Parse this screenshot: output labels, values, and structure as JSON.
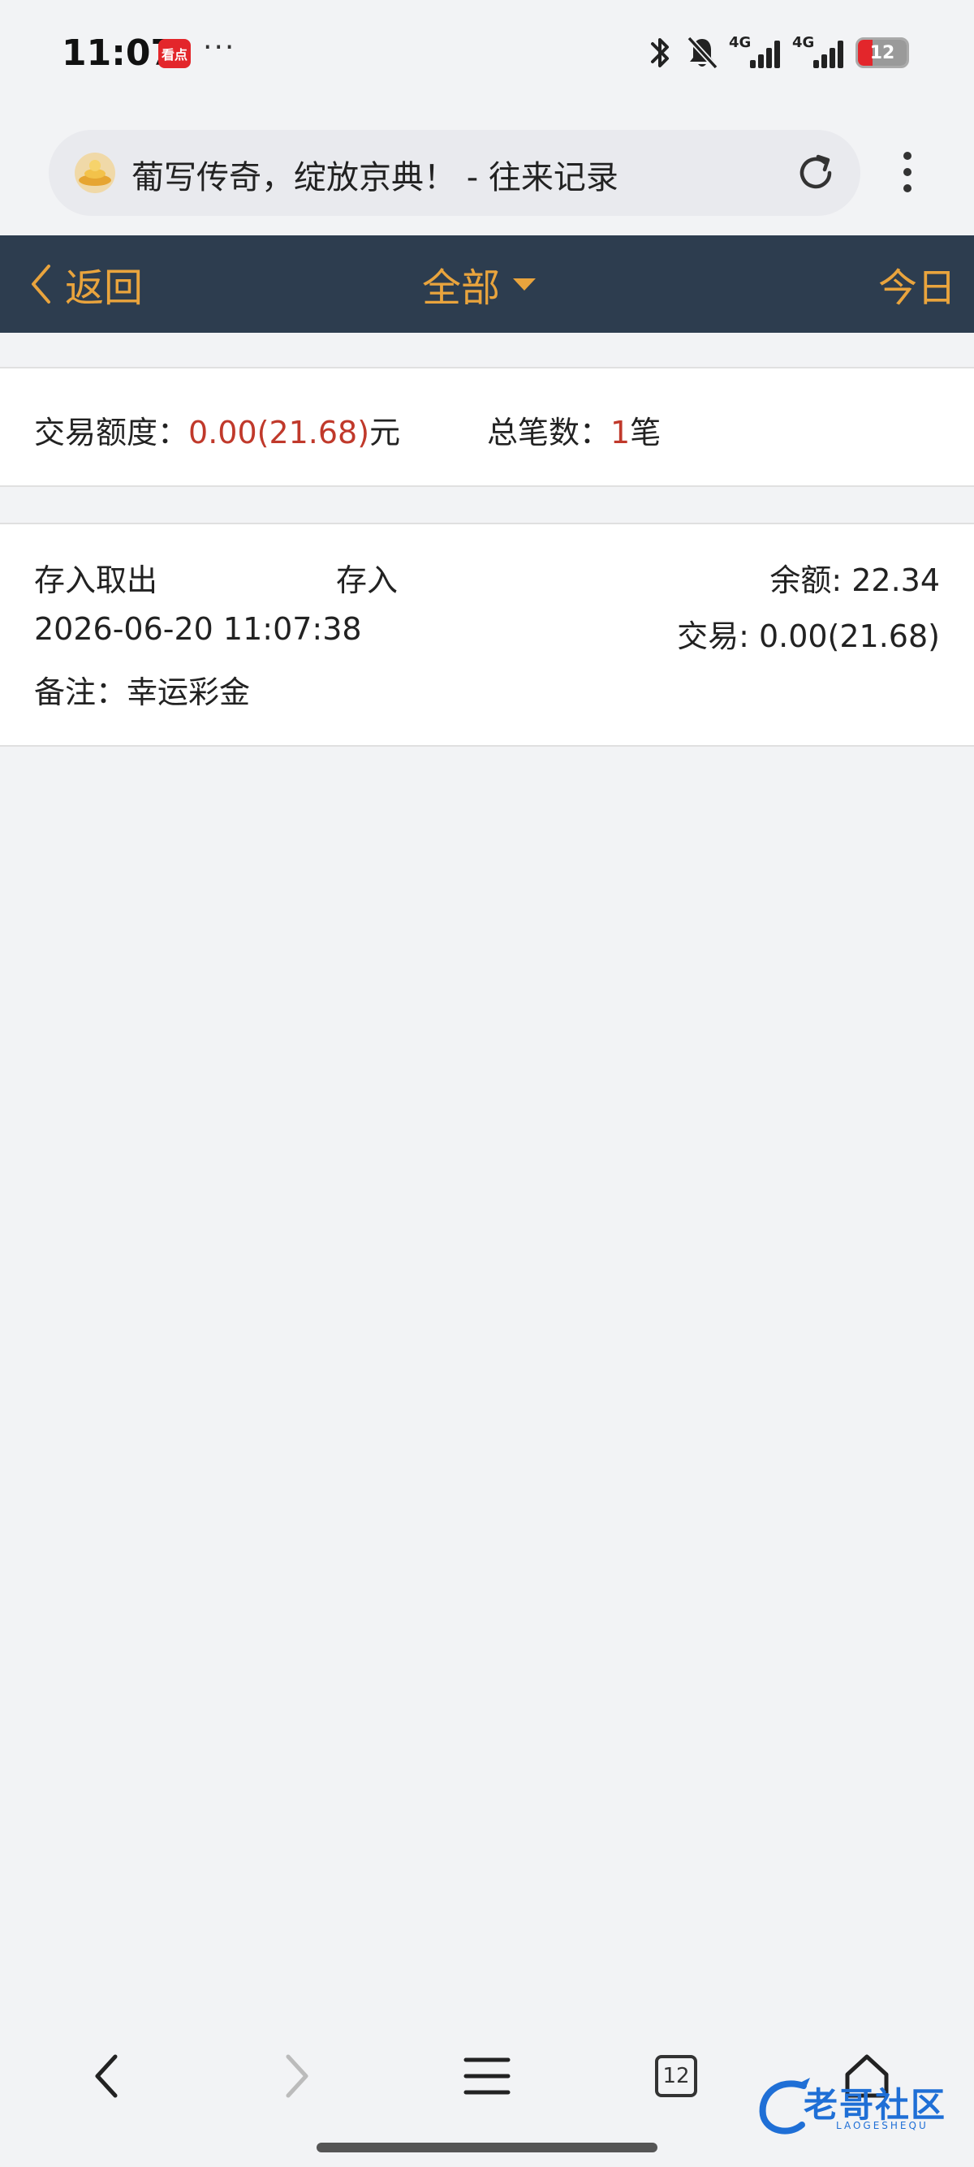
{
  "status_bar": {
    "time": "11:07",
    "app_badge": "看点",
    "more": "···",
    "network_1": "4G",
    "network_2": "4G",
    "battery": "12",
    "battery_level": 0.12
  },
  "browser": {
    "page_title": "葡写传奇，绽放京典！ - 往来记录",
    "tab_count": "12"
  },
  "header": {
    "back_label": "返回",
    "filter_label": "全部",
    "today_label": "今日"
  },
  "summary": {
    "amount_label": "交易额度：",
    "amount_value": "0.00(21.68)",
    "amount_unit": "元",
    "count_label": "总笔数：",
    "count_value": "1",
    "count_unit": "笔"
  },
  "records": [
    {
      "category": "存入取出",
      "type": "存入",
      "balance": "余额: 22.34",
      "datetime": "2026-06-20 11:07:38",
      "transaction": "交易: 0.00(21.68)",
      "note": "备注：幸运彩金"
    }
  ],
  "watermark": {
    "text": "老哥社区",
    "sub": "LAOGESHEQU"
  },
  "colors": {
    "header_bg": "#2d3d4f",
    "accent": "#e9a43d",
    "highlight": "#c0392b",
    "watermark": "#1f6fd6"
  }
}
